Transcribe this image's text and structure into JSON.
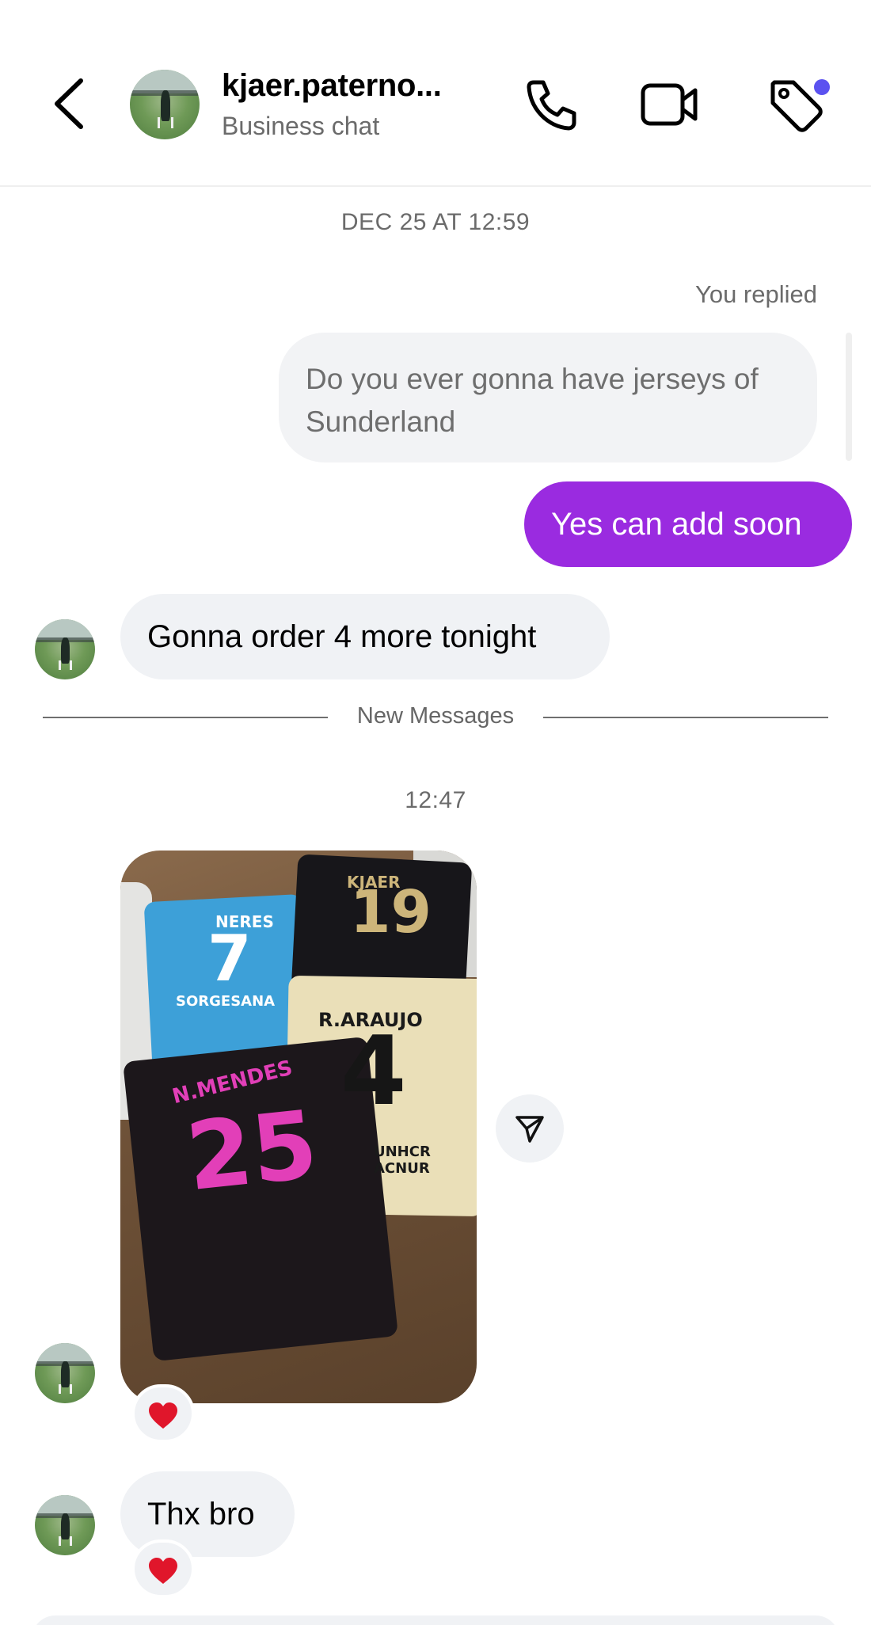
{
  "header": {
    "title": "kjaer.paterno...",
    "subtitle": "Business chat",
    "icons": [
      "back-icon",
      "phone-icon",
      "video-icon",
      "tag-icon"
    ]
  },
  "chat": {
    "timestamp_1": "DEC 25 AT 12:59",
    "replied_label": "You replied",
    "replied_to_text": "Do you ever gonna have jerseys of Sunderland",
    "outgoing_message": "Yes can add soon",
    "incoming_message_1": "Gonna order 4 more tonight",
    "new_messages_label": "New Messages",
    "timestamp_2": "12:47",
    "photo_texts": {
      "jersey_1_name": "NERES",
      "jersey_1_number": "7",
      "jersey_1_sponsor": "SORGESANA",
      "jersey_2_name": "KJAER",
      "jersey_2_number": "19",
      "jersey_3_name": "R.ARAUJO",
      "jersey_3_number": "4",
      "jersey_3_sponsor": "UNHCR ACNUR",
      "jersey_4_name": "N.MENDES",
      "jersey_4_number": "25"
    },
    "photo_reaction": "heart",
    "incoming_message_2": "Thx bro",
    "message_2_reaction": "heart"
  },
  "colors": {
    "accent_purple": "#9a2be0",
    "notification_dot": "#5b52f0",
    "bubble_gray": "#f0f2f5",
    "reaction_red": "#e0162b"
  }
}
